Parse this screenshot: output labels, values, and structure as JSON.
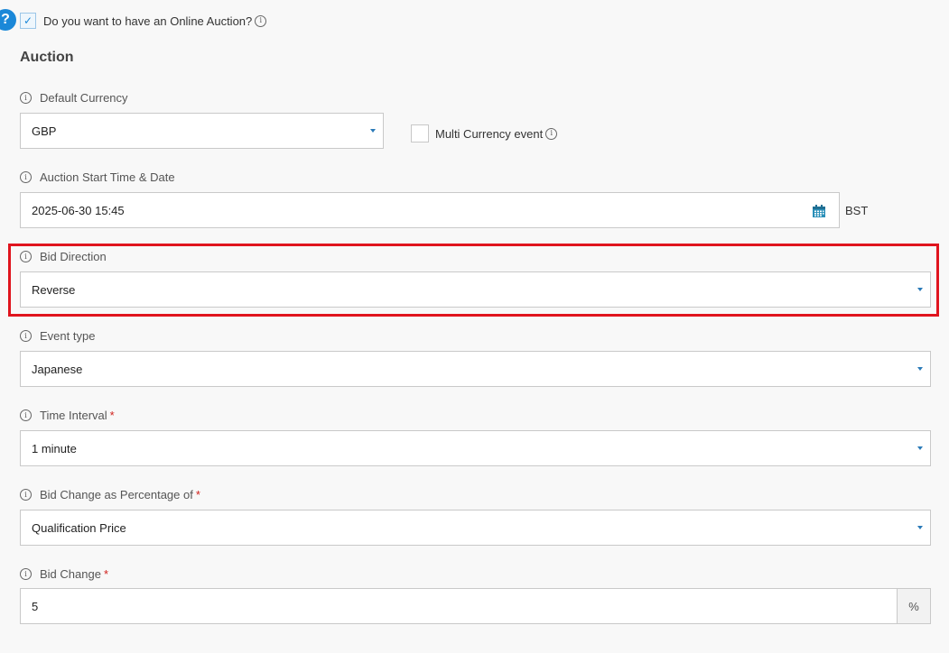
{
  "help": {
    "glyph": "?"
  },
  "online_auction": {
    "label": "Do you want to have an Online Auction?",
    "checked": true
  },
  "section": {
    "title": "Auction"
  },
  "default_currency": {
    "label": "Default Currency",
    "value": "GBP"
  },
  "multi_currency": {
    "label": "Multi Currency event",
    "checked": false
  },
  "start_time": {
    "label": "Auction Start Time & Date",
    "value": "2025-06-30 15:45",
    "timezone": "BST",
    "icon": "calendar-icon"
  },
  "bid_direction": {
    "label": "Bid Direction",
    "value": "Reverse"
  },
  "event_type": {
    "label": "Event type",
    "value": "Japanese"
  },
  "time_interval": {
    "label": "Time Interval",
    "required": "*",
    "value": "1 minute"
  },
  "bid_change_pct": {
    "label": "Bid Change as Percentage of",
    "required": "*",
    "value": "Qualification Price"
  },
  "bid_change": {
    "label": "Bid Change",
    "required": "*",
    "value": "5",
    "unit": "%"
  },
  "info_glyph": "i",
  "colors": {
    "accent": "#1b88d8",
    "highlight": "#e0141e",
    "required": "#d0211c"
  }
}
